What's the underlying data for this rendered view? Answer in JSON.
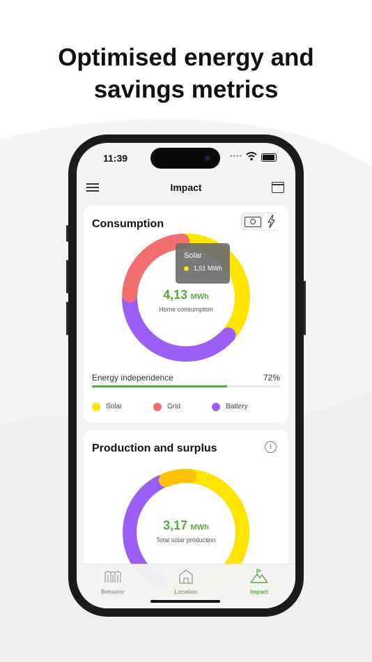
{
  "headline": {
    "line1": "Optimised energy and",
    "line2": "savings metrics"
  },
  "status_bar": {
    "time": "11:39",
    "icons": [
      "signal-dots-icon",
      "wifi-icon",
      "battery-icon"
    ]
  },
  "nav": {
    "title": "Impact",
    "left_icon": "menu-icon",
    "right_icon": "calendar-icon"
  },
  "consumption": {
    "title": "Consumption",
    "toggle_icons": [
      "money-icon",
      "bolt-icon"
    ],
    "value": "4,13",
    "unit": "MWh",
    "subtitle": "Home consumption",
    "tooltip": {
      "label": "Solar",
      "value": "1,51 MWh"
    },
    "energy_independence_label": "Energy independence",
    "energy_independence_value": "72%",
    "energy_independence_fraction": 0.72,
    "legend": [
      {
        "label": "Solar",
        "color": "#ffe400"
      },
      {
        "label": "Grid",
        "color": "#f26d6d"
      },
      {
        "label": "Battery",
        "color": "#9b5ff7"
      }
    ],
    "segments": [
      {
        "name": "Solar",
        "value": 1.51,
        "color": "#ffe400"
      },
      {
        "name": "Battery",
        "value": 1.62,
        "color": "#9b5ff7"
      },
      {
        "name": "Grid",
        "value": 1.0,
        "color": "#f26d6d"
      }
    ]
  },
  "production": {
    "title": "Production and surplus",
    "value": "3,17",
    "unit": "MWh",
    "subtitle": "Total solar production",
    "segments_colors": {
      "solar": "#ffe400",
      "battery": "#9b5ff7",
      "surplus": "#ffc107"
    }
  },
  "tabs": [
    {
      "label": "Behavior",
      "icon": "behavior-icon",
      "active": false
    },
    {
      "label": "Location",
      "icon": "home-icon",
      "active": false
    },
    {
      "label": "Impact",
      "icon": "impact-icon",
      "active": true
    }
  ],
  "colors": {
    "accent_green": "#5aa845"
  }
}
